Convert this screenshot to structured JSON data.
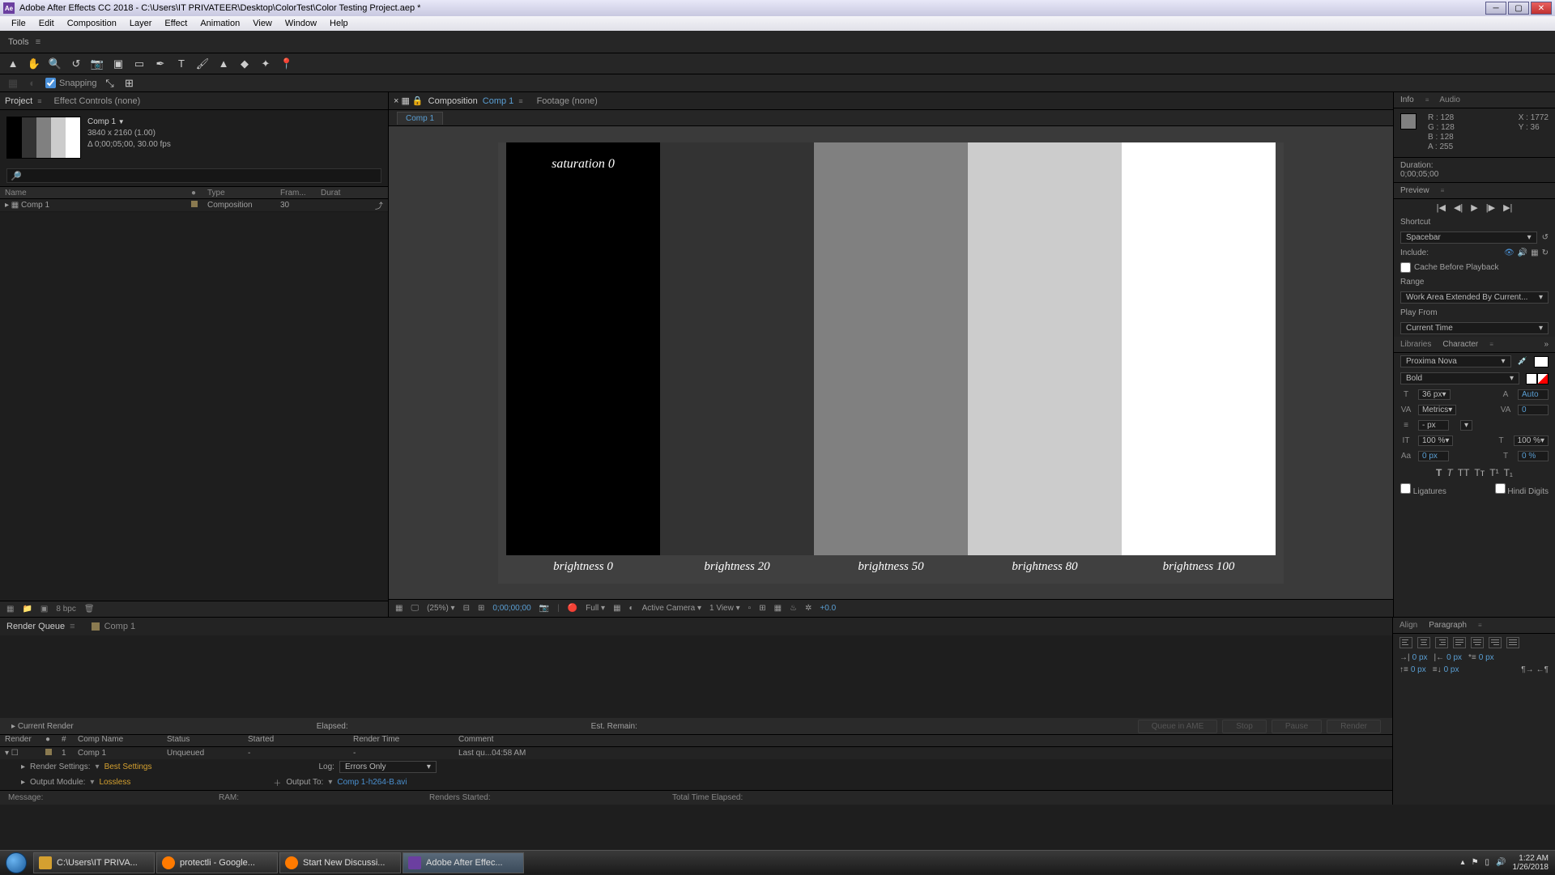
{
  "titlebar": {
    "app_icon": "Ae",
    "title": "Adobe After Effects CC 2018 - C:\\Users\\IT PRIVATEER\\Desktop\\ColorTest\\Color Testing Project.aep *"
  },
  "menubar": [
    "File",
    "Edit",
    "Composition",
    "Layer",
    "Effect",
    "Animation",
    "View",
    "Window",
    "Help"
  ],
  "tools_label": "Tools",
  "snapping": {
    "label": "Snapping",
    "checked": true
  },
  "project": {
    "tab_project": "Project",
    "tab_effects": "Effect Controls (none)",
    "name": "Comp 1",
    "res": "3840 x 2160 (1.00)",
    "dur": "Δ 0;00;05;00, 30.00 fps",
    "cols": {
      "name": "Name",
      "type": "Type",
      "frame": "Fram...",
      "dur": "Durat"
    },
    "row": {
      "name": "Comp 1",
      "type": "Composition",
      "frame": "30"
    },
    "bpc": "8 bpc"
  },
  "viewer": {
    "comp_tab": "Composition",
    "comp_name": "Comp 1",
    "footage_tab": "Footage (none)",
    "sub_tab": "Comp 1",
    "sat_label": "saturation 0",
    "bars": [
      {
        "bg": "#000000",
        "label": "brightness 0"
      },
      {
        "bg": "#333333",
        "label": "brightness 20"
      },
      {
        "bg": "#808080",
        "label": "brightness 50"
      },
      {
        "bg": "#cccccc",
        "label": "brightness 80"
      },
      {
        "bg": "#ffffff",
        "label": "brightness 100"
      }
    ],
    "ctrl": {
      "zoom": "(25%)",
      "time": "0;00;00;00",
      "quality": "Full",
      "camera": "Active Camera",
      "views": "1 View",
      "exp": "+0.0"
    }
  },
  "info": {
    "tab_info": "Info",
    "tab_audio": "Audio",
    "r": "R : 128",
    "g": "G : 128",
    "b": "B : 128",
    "a": "A : 255",
    "x": "X : 1772",
    "y": "Y : 36",
    "duration_lbl": "Duration:",
    "duration": "0;00;05;00"
  },
  "preview": {
    "tab": "Preview",
    "shortcut_lbl": "Shortcut",
    "shortcut": "Spacebar",
    "include_lbl": "Include:",
    "cache_cb": "Cache Before Playback",
    "range_lbl": "Range",
    "range": "Work Area Extended By Current...",
    "playfrom_lbl": "Play From",
    "playfrom": "Current Time"
  },
  "character": {
    "tab_lib": "Libraries",
    "tab_char": "Character",
    "font": "Proxima Nova",
    "weight": "Bold",
    "size": "36 px",
    "leading": "Auto",
    "kerning": "Metrics",
    "tracking": "0",
    "stroke": "- px",
    "vscale": "100 %",
    "hscale": "100 %",
    "baseline": "0 px",
    "tsume": "0 %",
    "ligatures": "Ligatures",
    "hindi": "Hindi Digits"
  },
  "align_tab": "Align",
  "paragraph": {
    "tab": "Paragraph",
    "indent_left": "0 px",
    "indent_right": "0 px",
    "indent_first": "0 px",
    "space_before": "0 px",
    "space_after": "0 px"
  },
  "render_queue": {
    "tab_rq": "Render Queue",
    "tab_comp": "Comp 1",
    "current": "Current Render",
    "elapsed": "Elapsed:",
    "remain": "Est. Remain:",
    "btns": [
      "Queue in AME",
      "Stop",
      "Pause",
      "Render"
    ],
    "hdr": {
      "render": "Render",
      "num": "#",
      "comp": "Comp Name",
      "status": "Status",
      "started": "Started",
      "time": "Render Time",
      "comment": "Comment"
    },
    "row": {
      "num": "1",
      "comp": "Comp 1",
      "status": "Unqueued",
      "started": "-",
      "time": "-",
      "comment": "Last qu...04:58 AM"
    },
    "rs_lbl": "Render Settings:",
    "rs_val": "Best Settings",
    "log_lbl": "Log:",
    "log_val": "Errors Only",
    "om_lbl": "Output Module:",
    "om_val": "Lossless",
    "out_lbl": "Output To:",
    "out_val": "Comp 1-h264-B.avi",
    "msg": "Message:",
    "ram": "RAM:",
    "rstart": "Renders Started:",
    "tte": "Total Time Elapsed:"
  },
  "taskbar": {
    "items": [
      {
        "icon": "folder",
        "label": "C:\\Users\\IT PRIVA..."
      },
      {
        "icon": "ff",
        "label": "protectli - Google..."
      },
      {
        "icon": "ff",
        "label": "Start New Discussi..."
      },
      {
        "icon": "ae",
        "label": "Adobe After Effec...",
        "active": true
      }
    ],
    "time": "1:22 AM",
    "date": "1/26/2018"
  }
}
